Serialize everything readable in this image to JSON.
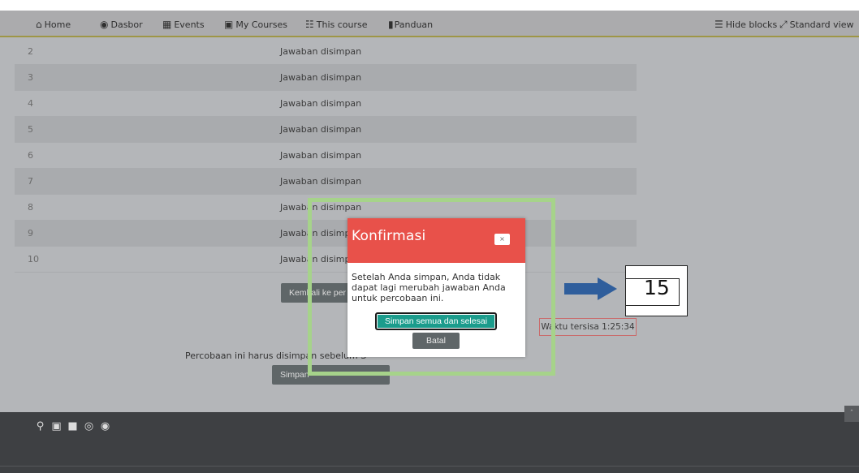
{
  "nav": {
    "home": "Home",
    "dasbor": "Dasbor",
    "events": "Events",
    "my_courses": "My Courses",
    "this_course": "This course",
    "panduan": "Panduan",
    "hide_blocks": "Hide blocks",
    "standard_view": "Standard view"
  },
  "summary_rows": [
    {
      "num": "2",
      "status": "Jawaban disimpan"
    },
    {
      "num": "3",
      "status": "Jawaban disimpan"
    },
    {
      "num": "4",
      "status": "Jawaban disimpan"
    },
    {
      "num": "5",
      "status": "Jawaban disimpan"
    },
    {
      "num": "6",
      "status": "Jawaban disimpan"
    },
    {
      "num": "7",
      "status": "Jawaban disimpan"
    },
    {
      "num": "8",
      "status": "Jawaban disimpan"
    },
    {
      "num": "9",
      "status": "Jawaban disimpan"
    },
    {
      "num": "10",
      "status": "Jawaban disimpan"
    }
  ],
  "return_button": "Kembali ke per",
  "timer": "Waktu tersisa 1:25:34",
  "note": "Percobaan ini harus disimpan sebelum S",
  "submit_all_button": "Simpan",
  "modal": {
    "title": "Konfirmasi",
    "close": "×",
    "body": "Setelah Anda simpan, Anda tidak dapat lagi merubah jawaban Anda untuk percobaan ini.",
    "confirm": "Simpan semua dan selesai",
    "cancel": "Batal"
  },
  "annotation": {
    "step_number": "15"
  },
  "colors": {
    "modal_header": "#e8514a",
    "confirm_button": "#1b9c8c",
    "highlight_frame": "#a6d38a",
    "arrow": "#2f5e9c"
  }
}
